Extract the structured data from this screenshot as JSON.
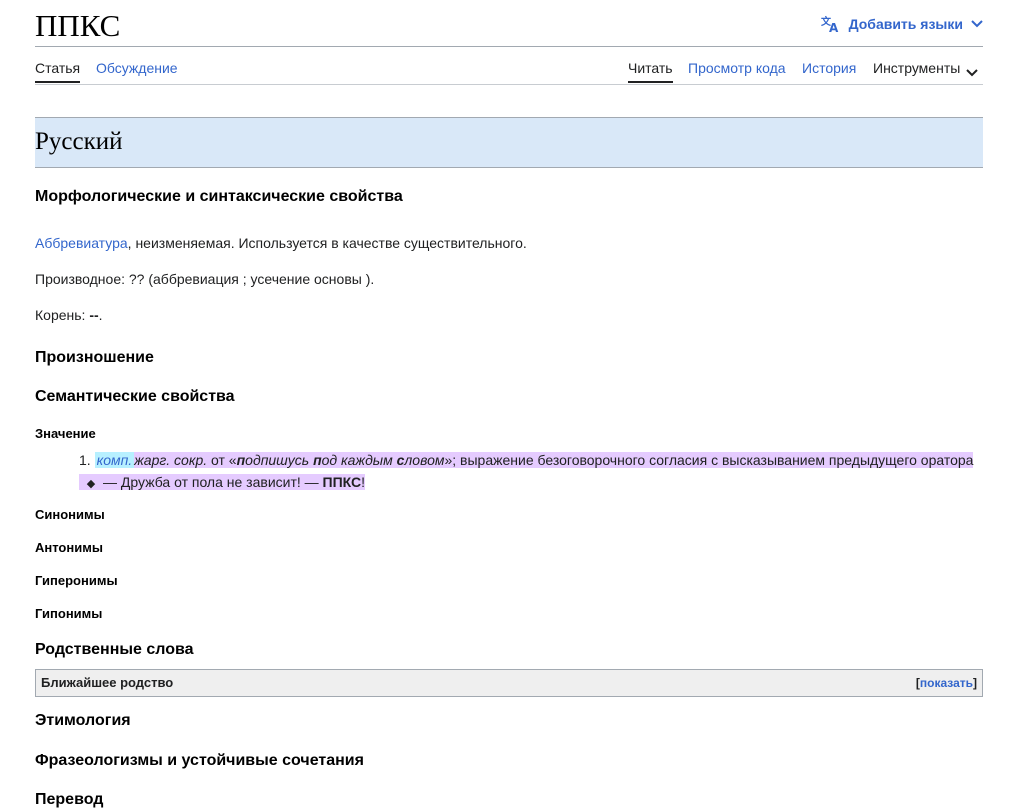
{
  "page": {
    "title": "ППКС",
    "add_languages": "Добавить языки"
  },
  "tabs": {
    "left": [
      "Статья",
      "Обсуждение"
    ],
    "right": {
      "read": "Читать",
      "view_source": "Просмотр кода",
      "history": "История",
      "tools": "Инструменты"
    }
  },
  "content": {
    "language_heading": "Русский",
    "morph_heading": "Морфологические и синтаксические свойства",
    "abbr_link": "Аббревиатура",
    "abbr_rest": ", неизменяемая. Используется в качестве существительного.",
    "derived": "Производное: ?? (аббревиация ; усечение основы ).",
    "root_label": "Корень: ",
    "root_value": "--",
    "root_end": ".",
    "pronunciation_heading": "Произношение",
    "semantic_heading": "Семантические свойства",
    "meaning_heading": "Значение",
    "meaning": {
      "number": "1.",
      "label_comp": "комп.",
      "labels_rest": "жарг. сокр.",
      "from": " от «",
      "p1_b": "п",
      "p1_r": "одпишусь ",
      "p2_b": "п",
      "p2_r": "од каждым ",
      "p3_b": "с",
      "p3_r": "ловом",
      "close": "»; выражение безоговорочного согласия с высказыванием предыдущего оратора"
    },
    "example": {
      "bullet": "◆",
      "text": "— Дружба от пола не зависит! — ",
      "bold": "ППКС",
      "end": "!"
    },
    "synonyms_heading": "Синонимы",
    "antonyms_heading": "Антонимы",
    "hyperonyms_heading": "Гиперонимы",
    "hyponyms_heading": "Гипонимы",
    "related_heading": "Родственные слова",
    "related_box_title": "Ближайшее родство",
    "related_show_open": "[",
    "related_show_link": "показать",
    "related_show_close": "]",
    "etymology_heading": "Этимология",
    "phraseology_heading": "Фразеологизмы и устойчивые сочетания",
    "translation_heading": "Перевод"
  },
  "colors": {
    "link": "#3366cc",
    "language_header_bg": "#d9e8f8",
    "highlight_label": "#b7f0ff",
    "highlight_meaning": "#e5cbff"
  },
  "icons": {
    "translate": "translate-icon",
    "chevron": "chevron-down-icon"
  }
}
